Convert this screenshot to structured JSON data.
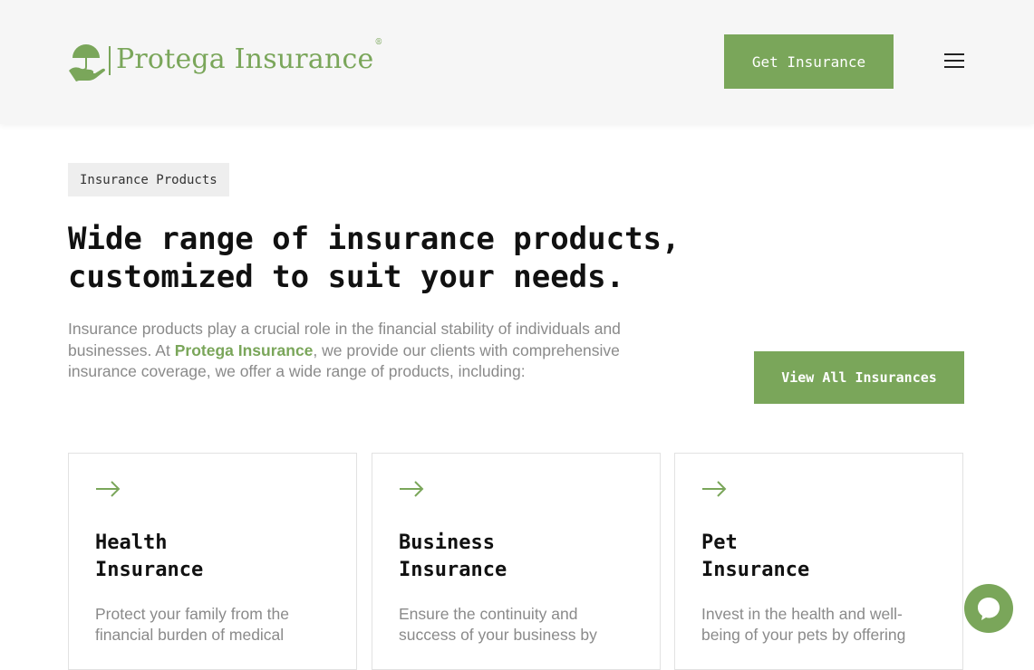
{
  "header": {
    "logo_text": "Protega Insurance",
    "logo_mark": "®",
    "cta_label": "Get Insurance",
    "menu_icon": "hamburger-menu-icon"
  },
  "hero": {
    "tag": "Insurance Products",
    "headline_line1": "Wide range of insurance products,",
    "headline_line2": "customized to suit your needs.",
    "intro_before": "Insurance products play a crucial role in the financial stability of individuals and businesses. At ",
    "intro_brand": "Protega Insurance",
    "intro_after": ", we provide our clients with comprehensive insurance coverage, we offer a wide range of products, including:",
    "view_all_label": "View All Insurances"
  },
  "cards": [
    {
      "title_line1": "Health",
      "title_line2": "Insurance",
      "description": "Protect your family from the financial burden of medical",
      "icon": "arrow-right-icon"
    },
    {
      "title_line1": "Business",
      "title_line2": "Insurance",
      "description": "Ensure the continuity and success of your business by",
      "icon": "arrow-right-icon"
    },
    {
      "title_line1": "Pet",
      "title_line2": "Insurance",
      "description": "Invest in the health and well-being of your pets by offering",
      "icon": "arrow-right-icon"
    }
  ],
  "chat": {
    "icon": "chat-bubble-icon"
  },
  "colors": {
    "brand_green": "#7aa65a",
    "header_bg": "#f6f6f6",
    "text_dark": "#111111",
    "text_muted": "#8a8a8a"
  }
}
